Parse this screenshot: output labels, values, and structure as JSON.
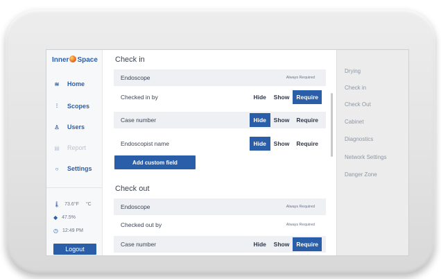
{
  "app": {
    "logo_text_1": "Inner",
    "logo_text_2": "Space"
  },
  "sidebar": {
    "items": [
      {
        "label": "Home",
        "icon": "home-icon",
        "glyph": "≋",
        "enabled": true
      },
      {
        "label": "Scopes",
        "icon": "scopes-icon",
        "glyph": "⫶",
        "enabled": true
      },
      {
        "label": "Users",
        "icon": "users-icon",
        "glyph": "♙",
        "enabled": true
      },
      {
        "label": "Report",
        "icon": "report-icon",
        "glyph": "▤",
        "enabled": false
      },
      {
        "label": "Settings",
        "icon": "settings-icon",
        "glyph": "○",
        "enabled": true
      }
    ],
    "status": {
      "temperature": "73.6°F",
      "temp_unit_toggle": "°C",
      "humidity": "47.5%",
      "time": "12:49 PM"
    },
    "logout_label": "Logout"
  },
  "main": {
    "check_in": {
      "title": "Check in",
      "rows": [
        {
          "label": "Endoscope",
          "always": "Always Required"
        },
        {
          "label": "Checked in by",
          "hide": "Hide",
          "show": "Show",
          "require": "Require",
          "selected": "require"
        },
        {
          "label": "Case number",
          "hide": "Hide",
          "show": "Show",
          "require": "Require",
          "selected": "hide"
        },
        {
          "label": "Endoscopist name",
          "hide": "Hide",
          "show": "Show",
          "require": "Require",
          "selected": "hide"
        }
      ],
      "add_custom_field_label": "Add custom field"
    },
    "check_out": {
      "title": "Check out",
      "rows": [
        {
          "label": "Endoscope",
          "always": "Always Required"
        },
        {
          "label": "Checked out by",
          "always": "Always Required"
        },
        {
          "label": "Case number",
          "hide": "Hide",
          "show": "Show",
          "require": "Require",
          "selected": "require"
        }
      ]
    }
  },
  "settings_nav": {
    "items": [
      "Drying",
      "Check in",
      "Check Out",
      "Cabinet",
      "Diagnostics",
      "Network Settings",
      "Danger Zone"
    ]
  },
  "colors": {
    "accent": "#2b5ea8",
    "row_shade": "#eef0f4"
  }
}
